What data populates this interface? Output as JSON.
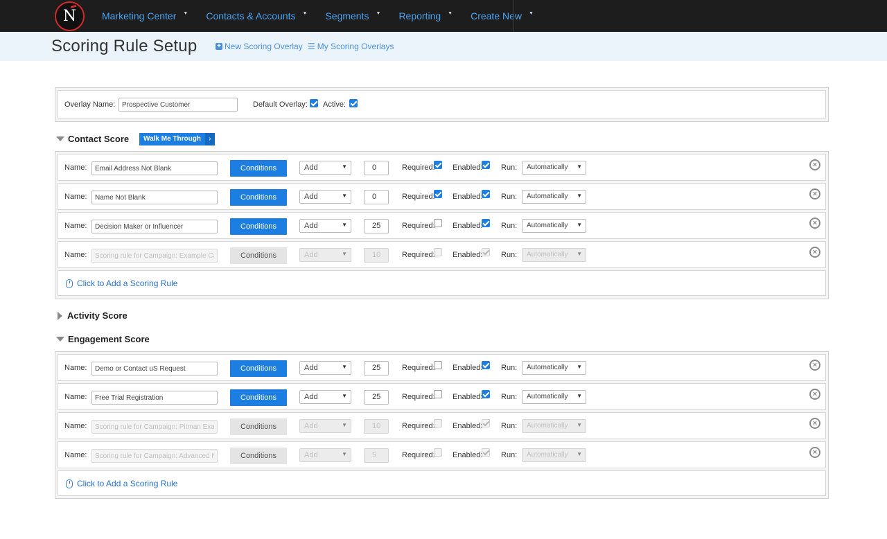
{
  "nav": {
    "logo_letter": "N",
    "items": [
      {
        "label": "Marketing Center"
      },
      {
        "label": "Contacts & Accounts"
      },
      {
        "label": "Segments"
      },
      {
        "label": "Reporting"
      },
      {
        "label": "Create New"
      }
    ]
  },
  "header": {
    "title": "Scoring Rule Setup",
    "new_overlay": "New Scoring Overlay",
    "my_overlays": "My Scoring Overlays"
  },
  "overlay": {
    "name_label": "Overlay Name:",
    "name_value": "Prospective Customer",
    "default_label": "Default Overlay:",
    "default_checked": true,
    "active_label": "Active:",
    "active_checked": true
  },
  "labels": {
    "name": "Name:",
    "conditions": "Conditions",
    "required": "Required:",
    "enabled": "Enabled:",
    "run": "Run:",
    "add_rule": "Click to Add a Scoring Rule",
    "walk_me": "Walk Me Through"
  },
  "contact_section": {
    "title": "Contact Score",
    "rules": [
      {
        "name": "Email Address Not Blank",
        "action": "Add",
        "points": "0",
        "required": true,
        "enabled": true,
        "run": "Automatically",
        "disabled": false
      },
      {
        "name": "Name Not Blank",
        "action": "Add",
        "points": "0",
        "required": true,
        "enabled": true,
        "run": "Automatically",
        "disabled": false
      },
      {
        "name": "Decision Maker or Influencer",
        "action": "Add",
        "points": "25",
        "required": false,
        "enabled": true,
        "run": "Automatically",
        "disabled": false
      },
      {
        "name": "Scoring rule for Campaign: Example Cam",
        "action": "Add",
        "points": "10",
        "required": false,
        "enabled": true,
        "run": "Automatically",
        "disabled": true
      }
    ]
  },
  "activity_section": {
    "title": "Activity Score"
  },
  "engagement_section": {
    "title": "Engagement Score",
    "rules": [
      {
        "name": "Demo or Contact uS Request",
        "action": "Add",
        "points": "25",
        "required": false,
        "enabled": true,
        "run": "Automatically",
        "disabled": false
      },
      {
        "name": "Free Trial Registration",
        "action": "Add",
        "points": "25",
        "required": false,
        "enabled": true,
        "run": "Automatically",
        "disabled": false
      },
      {
        "name": "Scoring rule for Campaign: Pitman Examp",
        "action": "Add",
        "points": "10",
        "required": false,
        "enabled": true,
        "run": "Automatically",
        "disabled": true
      },
      {
        "name": "Scoring rule for Campaign: Advanced Nu",
        "action": "Add",
        "points": "5",
        "required": false,
        "enabled": true,
        "run": "Automatically",
        "disabled": true
      }
    ]
  },
  "colors": {
    "nav_bg": "#1d1d1d",
    "nav_link": "#4aa3f0",
    "accent": "#1b7ee0",
    "subheader_bg": "#ebf4fb"
  }
}
